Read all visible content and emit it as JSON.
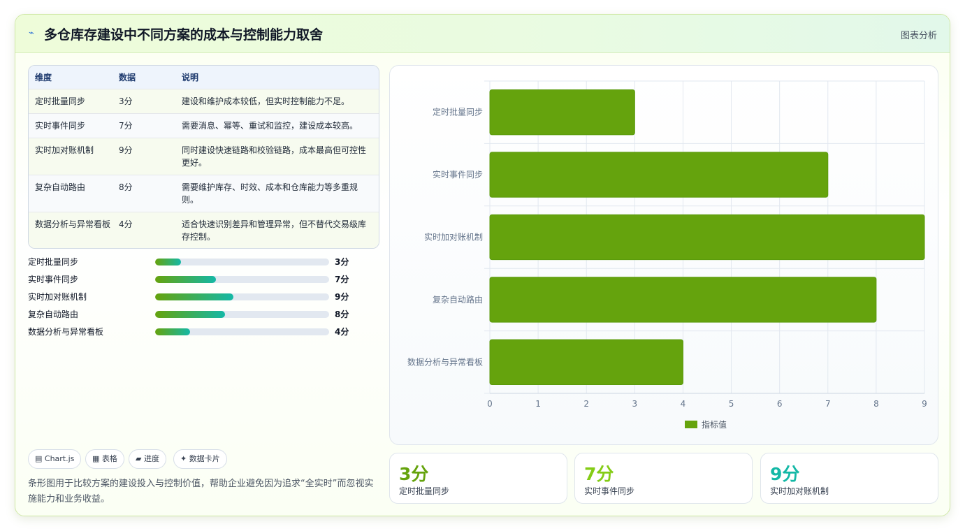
{
  "header": {
    "title": "多仓库存建设中不同方案的成本与控制能力取舍",
    "tag": "图表分析"
  },
  "table": {
    "headers": [
      "维度",
      "数据",
      "说明"
    ],
    "rows": [
      {
        "name": "定时批量同步",
        "value": "3分",
        "desc": "建设和维护成本较低，但实时控制能力不足。"
      },
      {
        "name": "实时事件同步",
        "value": "7分",
        "desc": "需要消息、幂等、重试和监控，建设成本较高。"
      },
      {
        "name": "实时加对账机制",
        "value": "9分",
        "desc": "同时建设快速链路和校验链路，成本最高但可控性更好。"
      },
      {
        "name": "复杂自动路由",
        "value": "8分",
        "desc": "需要维护库存、时效、成本和仓库能力等多重规则。"
      },
      {
        "name": "数据分析与异常看板",
        "value": "4分",
        "desc": "适合快速识别差异和管理异常，但不替代交易级库存控制。"
      }
    ]
  },
  "progress": [
    {
      "label": "定时批量同步",
      "value": "3分",
      "fraction": 0.15
    },
    {
      "label": "实时事件同步",
      "value": "7分",
      "fraction": 0.35
    },
    {
      "label": "实时加对账机制",
      "value": "9分",
      "fraction": 0.45
    },
    {
      "label": "复杂自动路由",
      "value": "8分",
      "fraction": 0.4
    },
    {
      "label": "数据分析与异常看板",
      "value": "4分",
      "fraction": 0.2
    }
  ],
  "chips": [
    "Chart.js",
    "表格",
    "进度",
    "数据卡片"
  ],
  "note": "条形图用于比较方案的建设投入与控制价值，帮助企业避免因为追求“全实时”而忽视实施能力和业务收益。",
  "stats": [
    {
      "value": "3分",
      "label": "定时批量同步",
      "color": "#65a30d"
    },
    {
      "value": "7分",
      "label": "实时事件同步",
      "color": "#84cc16"
    },
    {
      "value": "9分",
      "label": "实时加对账机制",
      "color": "#14b8a6"
    }
  ],
  "chart_data": {
    "type": "bar",
    "orientation": "horizontal",
    "categories": [
      "定时批量同步",
      "实时事件同步",
      "实时加对账机制",
      "复杂自动路由",
      "数据分析与异常看板"
    ],
    "series": [
      {
        "name": "指标值",
        "values": [
          3,
          7,
          9,
          8,
          4
        ],
        "color": "#65a30d"
      }
    ],
    "xlim": [
      0,
      9
    ],
    "xticks": [
      0,
      1,
      2,
      3,
      4,
      5,
      6,
      7,
      8,
      9
    ],
    "grid": true,
    "legend": "bottom"
  }
}
